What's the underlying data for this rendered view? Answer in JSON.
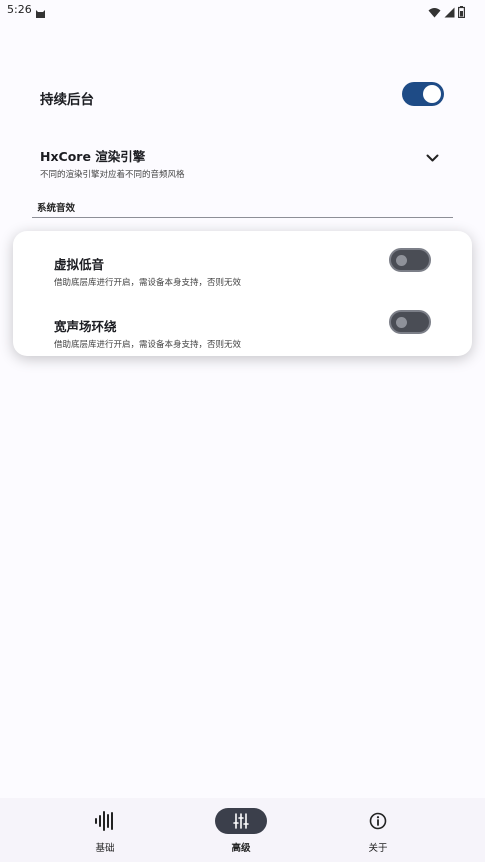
{
  "status": {
    "time": "5:26"
  },
  "settings": {
    "keep_background": {
      "title": "持续后台",
      "enabled": true
    },
    "engine": {
      "title": "HxCore 渲染引擎",
      "subtitle": "不同的渲染引擎对应着不同的音频风格"
    }
  },
  "system_effects": {
    "section_title": "系统音效",
    "items": [
      {
        "title": "虚拟低音",
        "subtitle": "借助底层库进行开启，需设备本身支持，否则无效",
        "enabled": false
      },
      {
        "title": "宽声场环绕",
        "subtitle": "借助底层库进行开启，需设备本身支持，否则无效",
        "enabled": false
      }
    ]
  },
  "nav": {
    "items": [
      {
        "label": "基础",
        "icon": "waveform-icon"
      },
      {
        "label": "高级",
        "icon": "sliders-icon",
        "active": true
      },
      {
        "label": "关于",
        "icon": "info-icon"
      }
    ]
  },
  "colors": {
    "accent": "#1e4b86",
    "background": "#fcfbff",
    "switch_off": "#4a4d55",
    "nav_active_pill": "#3b3f4b"
  }
}
